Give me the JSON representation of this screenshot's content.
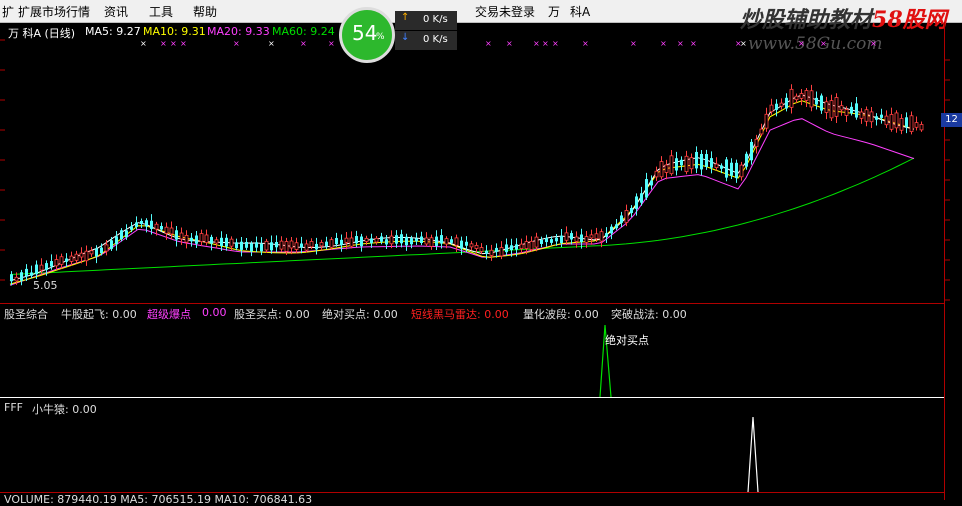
{
  "menu": {
    "item1": "扩展市场行情",
    "item2": "资讯",
    "item3": "工具",
    "item4": "帮助",
    "login_status": "交易未登录",
    "wan": "万",
    "stock": "科A"
  },
  "watermark": {
    "line1_a": "炒股辅助教材",
    "line1_b": "58股网",
    "line2": "www.58Gu.com"
  },
  "chart_header": {
    "prefix": "万  科A (日线)",
    "ma5": "MA5: 9.27",
    "ma10": "MA10: 9.31",
    "ma20": "MA20: 9.33",
    "ma60": "MA60: 9.24"
  },
  "gauge": {
    "value": "54",
    "unit": "%"
  },
  "speed": {
    "up_arrow": "↑",
    "up_value": "0 K/s",
    "down_arrow": "↓",
    "down_value": "0 K/s"
  },
  "price_box": "12",
  "low_label": "5.05",
  "indicator1": {
    "name": "股圣综合",
    "f1": "牛股起飞: 0.00",
    "f2": "超级爆点",
    "f2v": "0.00",
    "f3": "股圣买点: 0.00",
    "f4": "绝对买点: 0.00",
    "f5": "短线黑马雷达: 0.00",
    "f6": "量化波段: 0.00",
    "f7": "突破战法: 0.00",
    "signal": "绝对买点"
  },
  "indicator2": {
    "name": "FFF",
    "f1": "小牛猿: 0.00"
  },
  "volume": {
    "text": "VOLUME: 879440.19  MA5: 706515.19  MA10: 706841.63"
  },
  "colors": {
    "up": "#ff4040",
    "down": "#54fcfc",
    "ma5": "#ffffff",
    "ma10": "#ffff00",
    "ma20": "#ff40ff",
    "ma60": "#00e000",
    "grid_red": "#b00000"
  }
}
